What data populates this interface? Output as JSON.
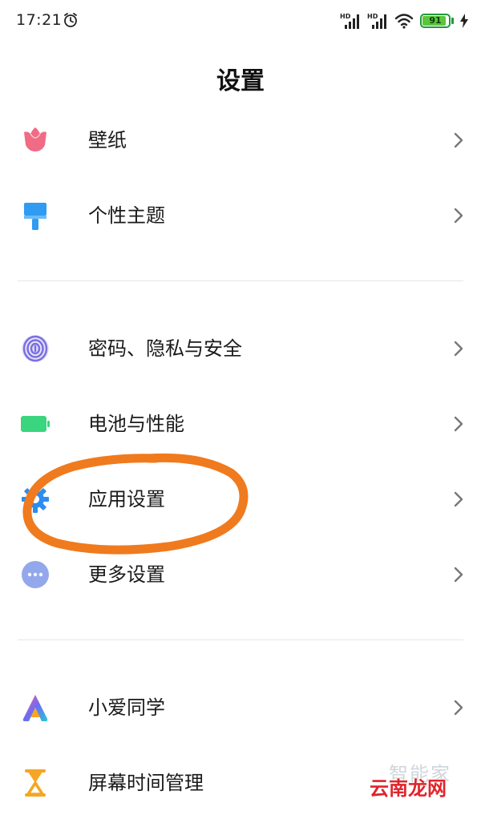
{
  "status_bar": {
    "time": "17:21",
    "battery_level": 91,
    "battery_label": "91",
    "signal_badge": "HD",
    "icons": [
      "alarm-icon",
      "signal-hd-icon",
      "signal-hd-icon",
      "wifi-icon",
      "battery-icon",
      "charging-icon"
    ]
  },
  "header": {
    "title": "设置"
  },
  "settings": {
    "items": [
      {
        "label": "壁纸",
        "icon": "wallpaper-icon",
        "color": "#f06b85"
      },
      {
        "label": "个性主题",
        "icon": "theme-brush-icon",
        "color": "#2f9bf3"
      },
      {
        "label": "密码、隐私与安全",
        "icon": "fingerprint-icon",
        "color": "#7a6fe0"
      },
      {
        "label": "电池与性能",
        "icon": "battery-icon",
        "color": "#3ad57e"
      },
      {
        "label": "应用设置",
        "icon": "gear-icon",
        "color": "#2b8df0"
      },
      {
        "label": "更多设置",
        "icon": "more-dots-icon",
        "color": "#93a8ec"
      },
      {
        "label": "小爱同学",
        "icon": "xiaoai-icon",
        "color": "#5a7cf5"
      },
      {
        "label": "屏幕时间管理",
        "icon": "hourglass-icon",
        "color": "#f5a623"
      }
    ]
  },
  "annotation": {
    "color": "#f07a1e",
    "target": "应用设置"
  },
  "watermark": {
    "faint_text": "智能家",
    "brand_text": "云南龙网",
    "brand_color": "#e0242b"
  }
}
